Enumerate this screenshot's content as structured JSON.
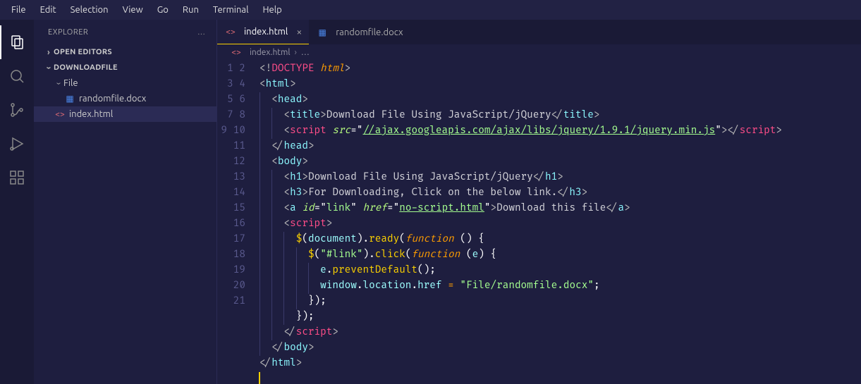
{
  "menubar": [
    "File",
    "Edit",
    "Selection",
    "View",
    "Go",
    "Run",
    "Terminal",
    "Help"
  ],
  "sidebar": {
    "title": "EXPLORER",
    "more_icon": "…",
    "open_editors_label": "OPEN EDITORS",
    "workspace_label": "DOWNLOADFILE",
    "folder": {
      "name": "File"
    },
    "files": {
      "randomfile": "randomfile.docx",
      "index": "index.html"
    }
  },
  "tabs": {
    "index": "index.html",
    "randomfile": "randomfile.docx"
  },
  "breadcrumb": {
    "file": "index.html",
    "sep": "›",
    "rest": "…"
  },
  "code": {
    "doctype": "DOCTYPE",
    "html_kw": "html",
    "tag_html": "html",
    "tag_head": "head",
    "tag_title": "title",
    "title_text": "Download File Using JavaScript/jQuery",
    "tag_script": "script",
    "src_attr": "src",
    "src_val": "//ajax.googleapis.com/ajax/libs/jquery/1.9.1/jquery.min.js",
    "tag_body": "body",
    "tag_h1": "h1",
    "h1_text": "Download File Using JavaScript/jQuery",
    "tag_h3": "h3",
    "h3_text": "For Downloading, Click on the below link.",
    "tag_a": "a",
    "id_attr": "id",
    "id_val": "link",
    "href_attr": "href",
    "href_val": "no-script.html",
    "a_text": "Download this file",
    "jq_dollar": "$",
    "jq_document": "document",
    "jq_ready": "ready",
    "jq_function": "function",
    "jq_link_sel": "\"#link\"",
    "jq_click": "click",
    "jq_e": "e",
    "jq_preventDefault": "preventDefault",
    "jq_window": "window",
    "jq_location": "location",
    "jq_href": "href",
    "jq_target": "\"File/randomfile.docx\""
  },
  "colors": {
    "background": "#1e1e3f",
    "accent": "#fad000"
  }
}
